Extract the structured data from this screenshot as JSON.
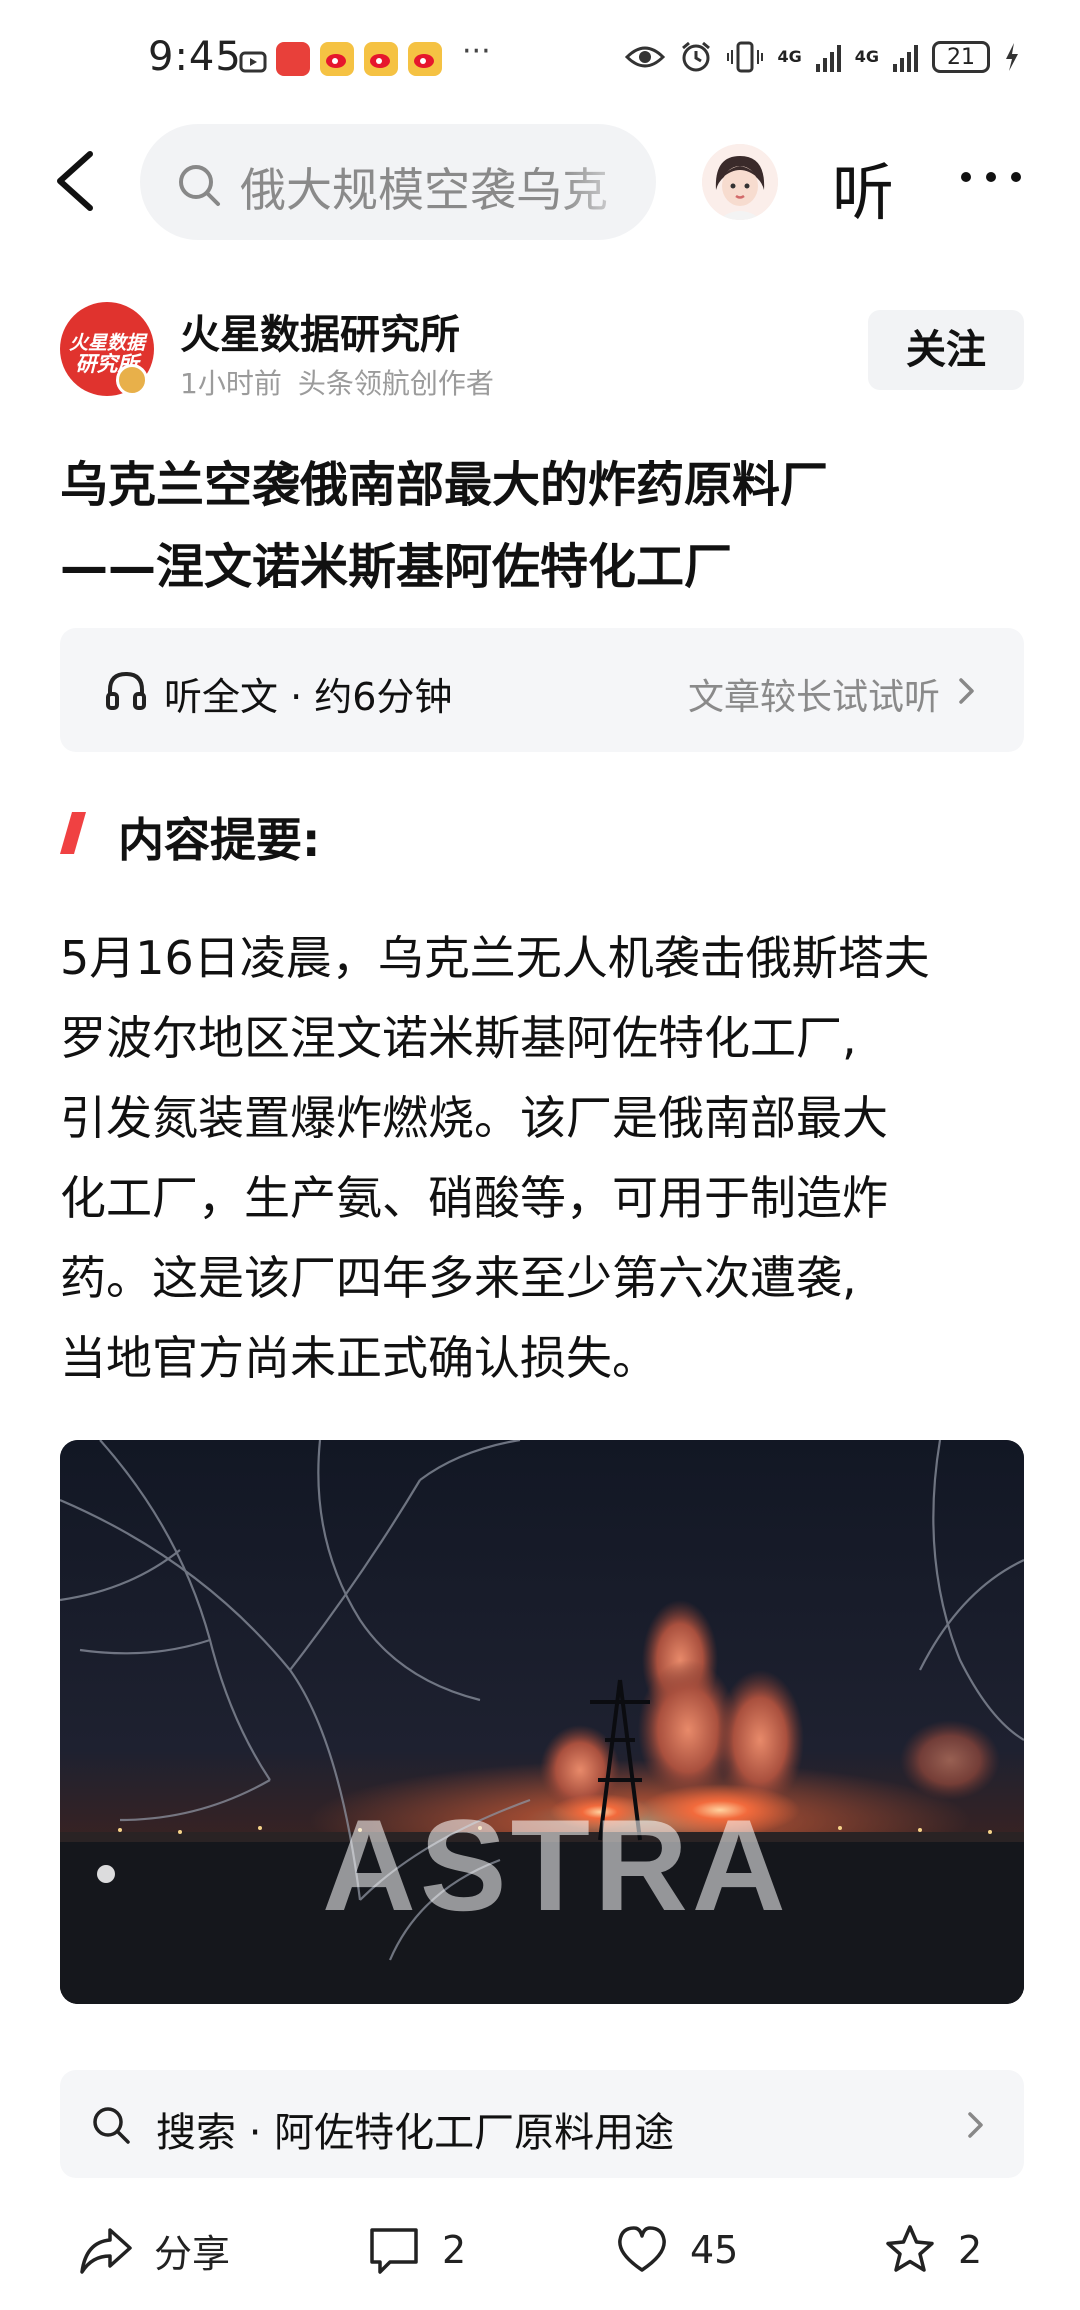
{
  "status_bar": {
    "time": "9:45",
    "dots": "···",
    "battery": "21",
    "network_1": "4G",
    "network_2": "4G",
    "icons": [
      "alarm-icon",
      "huawei-app-icon",
      "weibo-icon",
      "weibo-icon",
      "weibo-icon",
      "eye-icon",
      "alarm-clock-icon",
      "vibrate-icon",
      "signal-icon",
      "signal-icon",
      "charging-icon"
    ]
  },
  "header": {
    "search_placeholder": "俄大规模空袭乌克",
    "listen_label": "听"
  },
  "author": {
    "name": "火星数据研究所",
    "logo_line1": "火星数据",
    "logo_line2": "研究所",
    "time_ago": "1小时前",
    "role": "头条领航创作者",
    "follow_label": "关注"
  },
  "article": {
    "title_lines": [
      "乌克兰空袭俄南部最大的炸药原料厂",
      "——涅文诺米斯基阿佐特化工厂"
    ],
    "listen_label": "听全文 · 约6分钟",
    "listen_hint": "文章较长试试听",
    "summary_heading": "内容提要:",
    "body_lines": [
      "5月16日凌晨，乌克兰无人机袭击俄斯塔夫",
      "罗波尔地区涅文诺米斯基阿佐特化工厂,",
      "引发氮装置爆炸燃烧。该厂是俄南部最大",
      "化工厂，生产氨、硝酸等，可用于制造炸",
      "药。这是该厂四年多来至少第六次遭袭,",
      "当地官方尚未正式确认损失。"
    ],
    "image_watermark": "ASTRA"
  },
  "related_search": {
    "label": "搜索 · 阿佐特化工厂原料用途"
  },
  "bottom_bar": {
    "share_label": "分享",
    "comment_count": "2",
    "like_count": "45",
    "favorite_count": "2"
  },
  "colors": {
    "accent_red": "#f04142",
    "text_primary": "#111111",
    "text_secondary": "#8a8a8a",
    "panel_bg": "#f5f6f8"
  }
}
